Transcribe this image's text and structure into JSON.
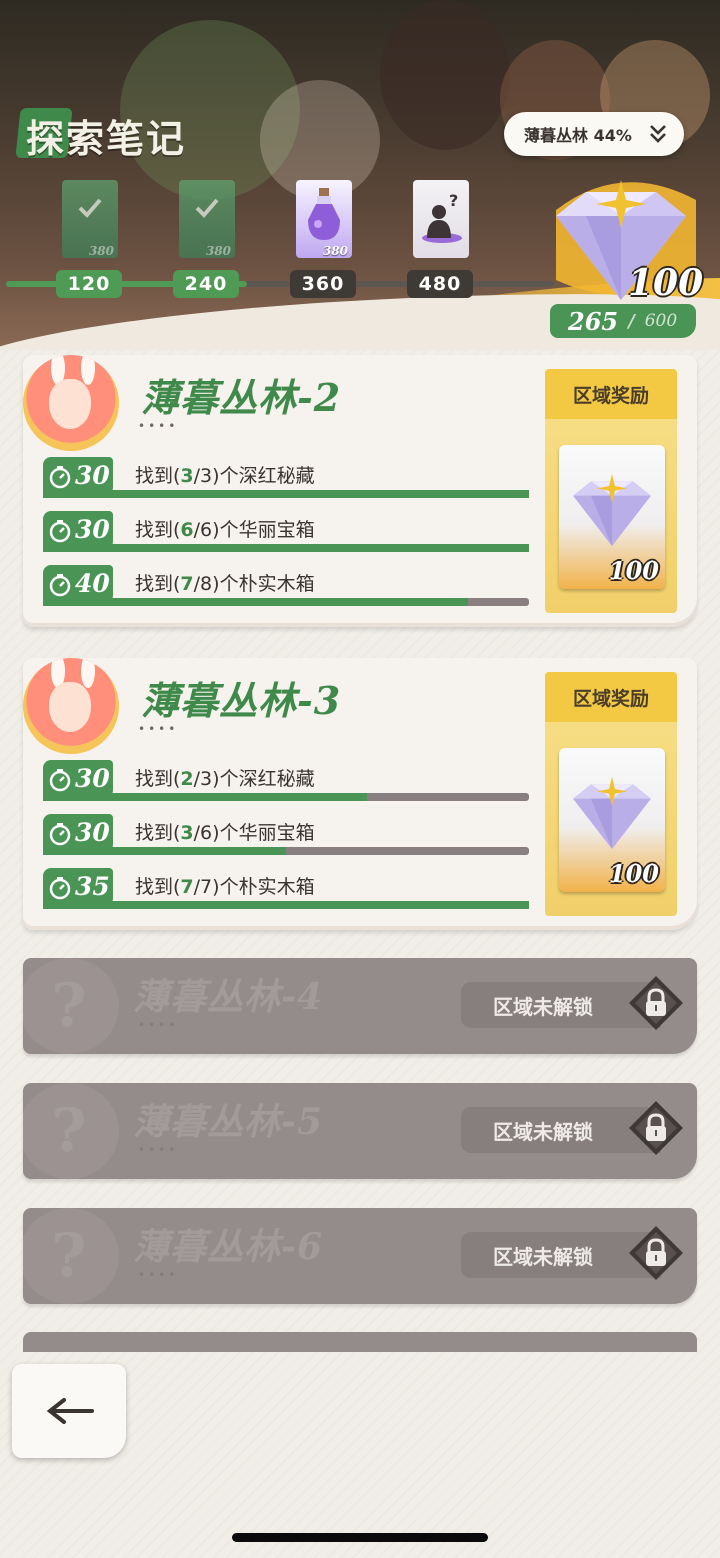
{
  "header": {
    "title": "探索笔记",
    "region_selector": {
      "label": "薄暮丛林 44%"
    },
    "milestones": [
      {
        "threshold": "120",
        "reward_amount": "380",
        "state": "claimed"
      },
      {
        "threshold": "240",
        "reward_amount": "380",
        "state": "claimed"
      },
      {
        "threshold": "360",
        "reward_amount": "380",
        "state": "available"
      },
      {
        "threshold": "480",
        "reward_amount": "",
        "state": "locked"
      }
    ],
    "milestone_progress_fraction": 0.44,
    "gem_reward_count": "100",
    "points_current": "265",
    "points_separator": "/",
    "points_max": "600"
  },
  "zones": [
    {
      "name": "薄暮丛林-2",
      "dots": "••••",
      "reward_title": "区域奖励",
      "reward_count": "100",
      "tasks": [
        {
          "points": "30",
          "prefix": "找到(",
          "found": "3",
          "total": "/3)",
          "suffix": "个深红秘藏",
          "progress": 1.0
        },
        {
          "points": "30",
          "prefix": "找到(",
          "found": "6",
          "total": "/6)",
          "suffix": "个华丽宝箱",
          "progress": 1.0
        },
        {
          "points": "40",
          "prefix": "找到(",
          "found": "7",
          "total": "/8)",
          "suffix": "个朴实木箱",
          "progress": 0.875
        }
      ]
    },
    {
      "name": "薄暮丛林-3",
      "dots": "••••",
      "reward_title": "区域奖励",
      "reward_count": "100",
      "tasks": [
        {
          "points": "30",
          "prefix": "找到(",
          "found": "2",
          "total": "/3)",
          "suffix": "个深红秘藏",
          "progress": 0.667
        },
        {
          "points": "30",
          "prefix": "找到(",
          "found": "3",
          "total": "/6)",
          "suffix": "个华丽宝箱",
          "progress": 0.5
        },
        {
          "points": "35",
          "prefix": "找到(",
          "found": "7",
          "total": "/7)",
          "suffix": "个朴实木箱",
          "progress": 1.0
        }
      ]
    }
  ],
  "locked_zones": [
    {
      "name": "薄暮丛林-4",
      "dots": "••••",
      "status": "区域未解锁",
      "q": "?"
    },
    {
      "name": "薄暮丛林-5",
      "dots": "••••",
      "status": "区域未解锁",
      "q": "?"
    },
    {
      "name": "薄暮丛林-6",
      "dots": "••••",
      "status": "区域未解锁",
      "q": "?"
    }
  ],
  "colors": {
    "accent_green": "#4a9455",
    "reward_gold": "#f3c944",
    "locked_gray": "#938c8b",
    "track_dark": "#3e3a36"
  }
}
